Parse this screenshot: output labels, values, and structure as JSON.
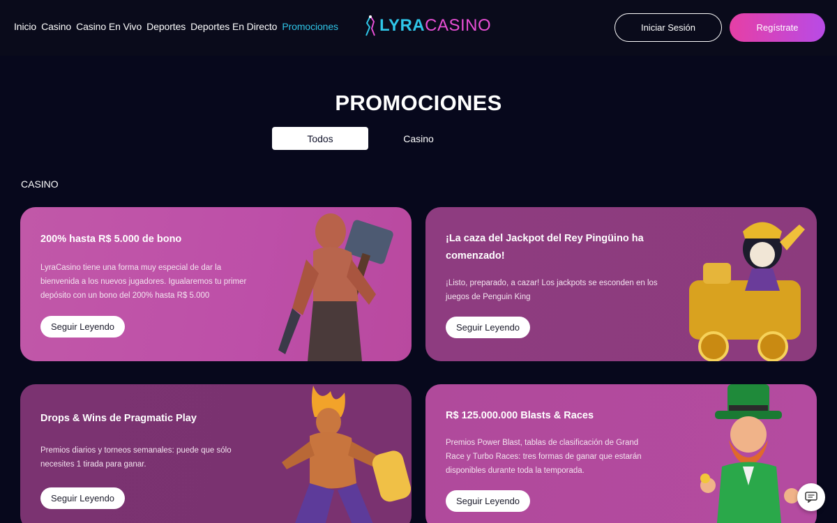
{
  "nav": {
    "items": [
      {
        "label": "Inicio"
      },
      {
        "label": "Casino"
      },
      {
        "label": "Casino En Vivo"
      },
      {
        "label": "Deportes"
      },
      {
        "label": "Deportes En Directo"
      },
      {
        "label": "Promociones",
        "active": true
      }
    ]
  },
  "logo": {
    "part1": "LYRA",
    "part2": "CASINO"
  },
  "auth": {
    "login": "Iniciar Sesión",
    "register": "Regístrate"
  },
  "page": {
    "title": "PROMOCIONES"
  },
  "tabs": [
    {
      "label": "Todos",
      "selected": true
    },
    {
      "label": "Casino",
      "selected": false
    }
  ],
  "section": {
    "label": "CASINO"
  },
  "promos": [
    {
      "title": "200% hasta R$ 5.000 de bono",
      "description": "LyraCasino tiene una forma muy especial de dar la bienvenida a los nuevos jugadores. Igualaremos tu primer depósito con un bono del 200% hasta R$ 5.000",
      "button": "Seguir Leyendo"
    },
    {
      "title": "¡La caza del Jackpot del Rey Pingüino ha comenzado!",
      "description": "¡Listo, preparado, a cazar! Los jackpots se esconden en los juegos de Penguin King",
      "button": "Seguir Leyendo"
    },
    {
      "title": "Drops & Wins de Pragmatic Play",
      "description": "Premios diarios y torneos semanales: puede que sólo necesites 1 tirada para ganar.",
      "button": "Seguir Leyendo"
    },
    {
      "title": "R$ 125.000.000 Blasts & Races",
      "description": "Premios Power Blast, tablas de clasificación de Grand Race y Turbo Races: tres formas de ganar que estarán disponibles durante toda la temporada.",
      "button": "Seguir Leyendo"
    }
  ],
  "colors": {
    "background": "#07081c",
    "accent": "#2fc6e8",
    "brand_pink": "#e94fd6"
  },
  "icons": {
    "chat": "chat-icon"
  }
}
